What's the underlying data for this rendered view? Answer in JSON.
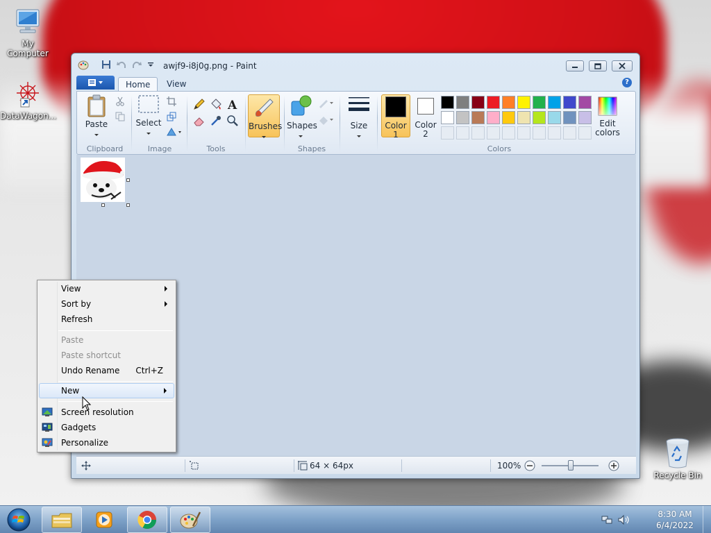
{
  "desktop": {
    "icons": [
      {
        "label": "My Computer",
        "icon": "computer-icon"
      },
      {
        "label": "DataWagon...",
        "icon": "datawagon-shortcut-icon"
      },
      {
        "label": "Recycle Bin",
        "icon": "recycle-bin-icon"
      }
    ]
  },
  "paint": {
    "title": "awjf9-i8j0g.png - Paint",
    "tabs": [
      "Home",
      "View"
    ],
    "groups": {
      "clipboard": "Clipboard",
      "image": "Image",
      "tools": "Tools",
      "shapes": "Shapes",
      "colors": "Colors"
    },
    "buttons": {
      "paste": "Paste",
      "select": "Select",
      "brushes": "Brushes",
      "shapes": "Shapes",
      "size": "Size",
      "color1_line1": "Color",
      "color1_line2": "1",
      "color2_line1": "Color",
      "color2_line2": "2",
      "edit_colors_line1": "Edit",
      "edit_colors_line2": "colors"
    },
    "palette_row1": [
      "#000000",
      "#7f7f7f",
      "#880015",
      "#ed1c24",
      "#ff7f27",
      "#fff200",
      "#22b14c",
      "#00a2e8",
      "#3f48cc",
      "#a349a4"
    ],
    "palette_row2": [
      "#ffffff",
      "#c3c3c3",
      "#b97a57",
      "#ffaec9",
      "#ffc90e",
      "#efe4b0",
      "#b5e61d",
      "#99d9ea",
      "#7092be",
      "#c8bfe7"
    ],
    "color1": "#000000",
    "color2": "#ffffff",
    "status": {
      "size": "64 × 64px",
      "zoom": "100%"
    }
  },
  "context_menu": {
    "items": [
      {
        "label": "View",
        "submenu": true
      },
      {
        "label": "Sort by",
        "submenu": true
      },
      {
        "label": "Refresh"
      },
      {
        "label": "Paste",
        "disabled": true
      },
      {
        "label": "Paste shortcut",
        "disabled": true
      },
      {
        "label": "Undo Rename",
        "shortcut": "Ctrl+Z"
      },
      {
        "label": "New",
        "submenu": true
      },
      {
        "label": "Screen resolution",
        "icon": "screen-resolution-icon"
      },
      {
        "label": "Gadgets",
        "icon": "gadgets-icon"
      },
      {
        "label": "Personalize",
        "icon": "personalize-icon"
      }
    ]
  },
  "taskbar": {
    "apps": [
      "file-explorer-icon",
      "media-player-icon",
      "chrome-icon",
      "paint-icon"
    ],
    "time": "8:30 AM",
    "date": "6/4/2022"
  }
}
